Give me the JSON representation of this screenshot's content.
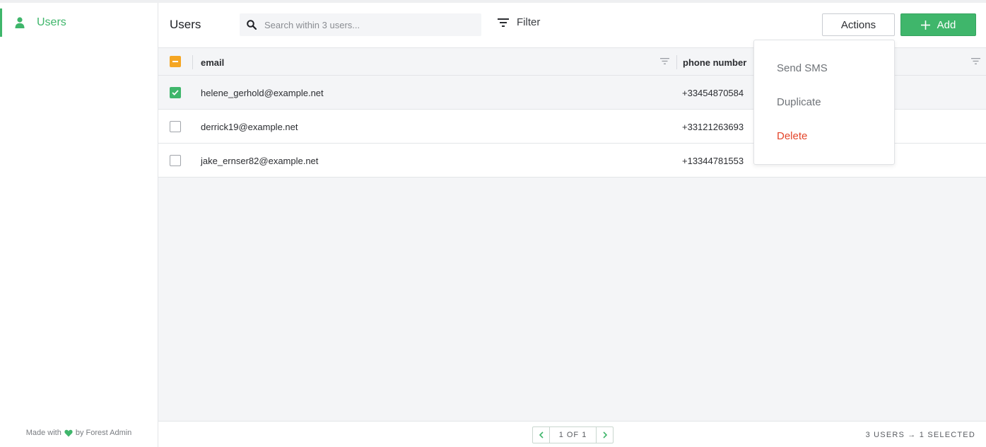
{
  "sidebar": {
    "items": [
      {
        "label": "Users",
        "icon": "user-icon"
      }
    ],
    "footer": {
      "made_with": "Made with",
      "by": "by Forest Admin",
      "icon": "heart-icon"
    }
  },
  "header": {
    "title": "Users",
    "search": {
      "placeholder": "Search within 3 users...",
      "value": ""
    },
    "filter_label": "Filter",
    "actions_label": "Actions",
    "add_label": "Add"
  },
  "table": {
    "columns": [
      {
        "label": "email"
      },
      {
        "label": "phone number"
      }
    ],
    "rows": [
      {
        "email": "helene_gerhold@example.net",
        "phone": "+33454870584",
        "selected": true
      },
      {
        "email": "derrick19@example.net",
        "phone": "+33121263693",
        "selected": false
      },
      {
        "email": "jake_ernser82@example.net",
        "phone": "+13344781553",
        "selected": false
      }
    ]
  },
  "footer": {
    "pagination": "1 OF 1",
    "status": "3 USERS → 1 SELECTED"
  },
  "actions_menu": {
    "items": [
      {
        "label": "Send SMS"
      },
      {
        "label": "Duplicate"
      },
      {
        "label": "Delete"
      }
    ]
  },
  "colors": {
    "brand": "#3fb66b",
    "partial_check": "#f5a623",
    "danger": "#e4452a"
  }
}
